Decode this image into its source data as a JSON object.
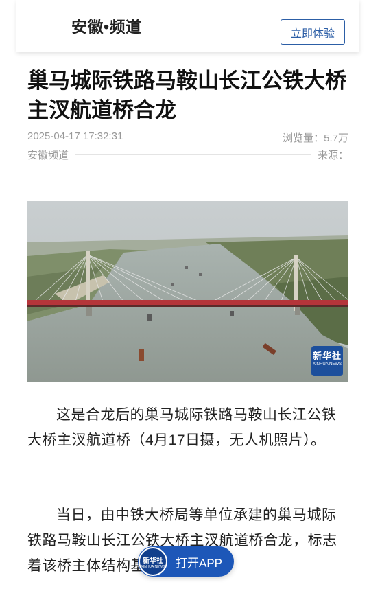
{
  "header": {
    "brand": "安徽•频道",
    "open_button": "立即体验"
  },
  "article": {
    "title": "巢马城际铁路马鞍山长江公铁大桥主汊航道桥合龙",
    "datetime": "2025-04-17 17:32:31",
    "views": "浏览量：5.7万",
    "channel": "安徽频道",
    "source": "来源：",
    "photo": {
      "watermark_cn": "新华社",
      "watermark_en": "XINHUA NEWS"
    },
    "paragraphs": [
      "这是合龙后的巢马城际铁路马鞍山长江公铁大桥主汊航道桥（4月17日摄，无人机照片）。",
      "当日，由中铁大桥局等单位承建的巢马城际铁路马鞍山长江公铁大桥主汊航道桥合龙，标志着该桥主体结构基本完成。"
    ]
  },
  "floating": {
    "logo_cn": "新华社",
    "logo_en": "XINHUA NEWS",
    "label": "打开APP"
  },
  "colors": {
    "accent": "#2c5ea6",
    "float_bg": "#1d57b8",
    "bridge": "#b5353a"
  }
}
